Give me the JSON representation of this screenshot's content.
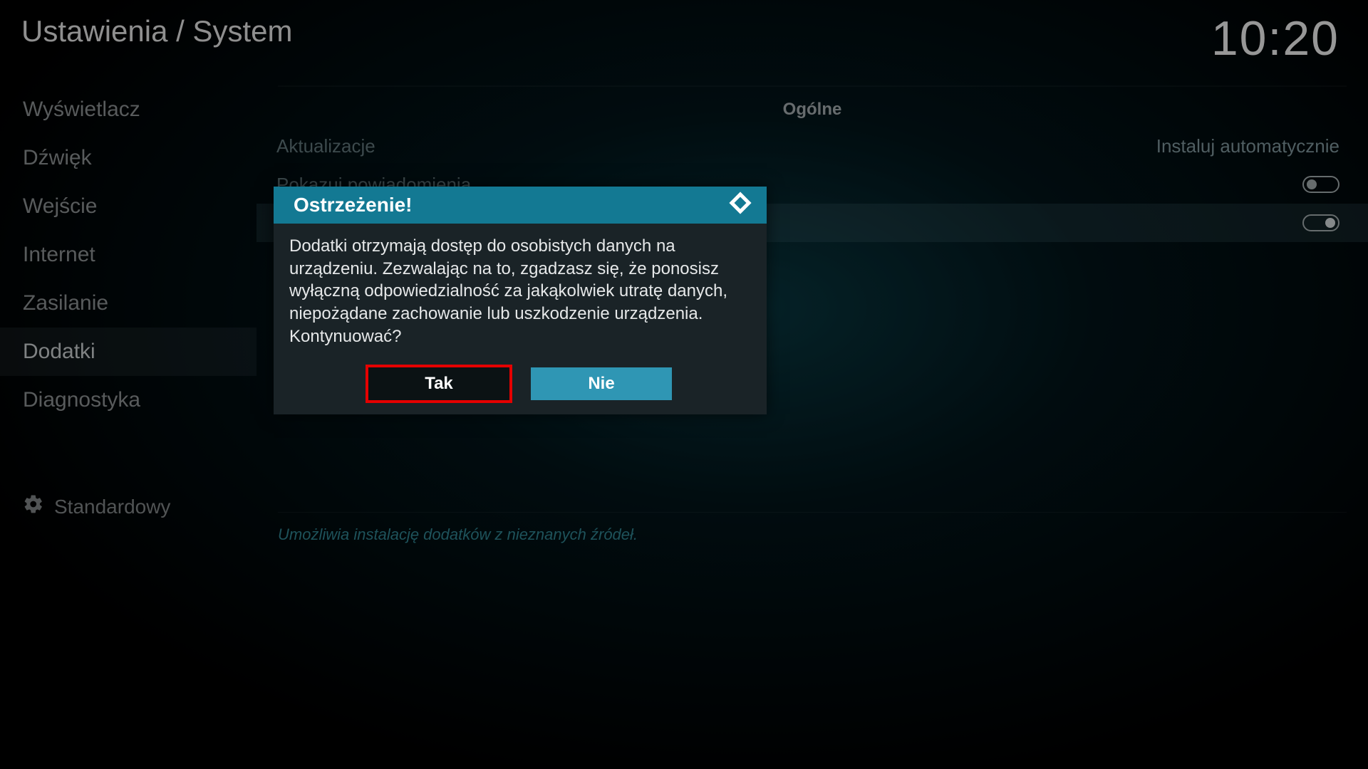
{
  "header": {
    "breadcrumb": "Ustawienia / System",
    "clock": "10:20"
  },
  "sidebar": {
    "items": [
      {
        "label": "Wyświetlacz"
      },
      {
        "label": "Dźwięk"
      },
      {
        "label": "Wejście"
      },
      {
        "label": "Internet"
      },
      {
        "label": "Zasilanie"
      },
      {
        "label": "Dodatki"
      },
      {
        "label": "Diagnostyka"
      }
    ],
    "selected_index": 5,
    "level_label": "Standardowy"
  },
  "main": {
    "section_title": "Ogólne",
    "rows": [
      {
        "label": "Aktualizacje",
        "kind": "select",
        "value": "Instaluj automatycznie"
      },
      {
        "label": "Pokazuj powiadomienia",
        "kind": "toggle",
        "on": false
      },
      {
        "label": "",
        "kind": "toggle",
        "on": true,
        "highlight": true
      }
    ],
    "help_text": "Umożliwia instalację dodatków z nieznanych źródeł."
  },
  "modal": {
    "title": "Ostrzeżenie!",
    "body": "Dodatki otrzymają dostęp do osobistych danych na urządzeniu. Zezwalając na to, zgadzasz się, że ponosisz wyłączną odpowiedzialność za jakąkolwiek utratę danych, niepożądane zachowanie lub uszkodzenie urządzenia. Kontynuować?",
    "yes": "Tak",
    "no": "Nie"
  }
}
